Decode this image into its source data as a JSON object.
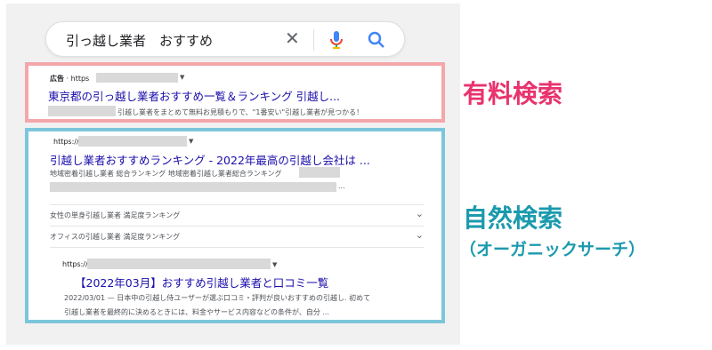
{
  "search": {
    "query": "引っ越し業者　おすすめ",
    "clear_icon": "close-icon",
    "mic_icon": "microphone-icon",
    "search_icon": "search-icon"
  },
  "ad_result": {
    "ad_label": "広告",
    "url_prefix": "· https",
    "title": "東京都の引っ越し業者おすすめ一覧＆ランキング 引越し...",
    "description": "引越し業者をまとめて無料お見積もりで、\"1番安い\"引越し業者が見つかる！"
  },
  "organic_result": {
    "url_prefix": "https://",
    "title": "引越し業者おすすめランキング - 2022年最高の引越し会社は ...",
    "description": "地域密着引越し業者 総合ランキング 地域密着引越し業者総合ランキング",
    "ellipsis": "...",
    "rows": [
      {
        "label": "女性の単身引越し業者 満足度ランキング"
      },
      {
        "label": "オフィスの引越し業者 満足度ランキング"
      }
    ],
    "sub": {
      "url_prefix": "https://",
      "title": "【2022年03月】おすすめ引越し業者と口コミ一覧",
      "desc1": "2022/03/01 — 日本中の引越し侍ユーザーが選ぶ口コミ・評判が良いおすすめの引越し. 初めて",
      "desc2": "引越し業者を最終的に決めるときには、料金やサービス内容などの条件が、自分 ..."
    }
  },
  "labels": {
    "paid": "有料検索",
    "organic": "自然検索",
    "organic_sub": "（オーガニックサーチ）"
  },
  "colors": {
    "paid_accent": "#e8336e",
    "paid_border": "#f4a7ab",
    "organic_accent": "#1b9aad",
    "organic_border": "#7cc6dc",
    "link": "#1a0dab"
  }
}
